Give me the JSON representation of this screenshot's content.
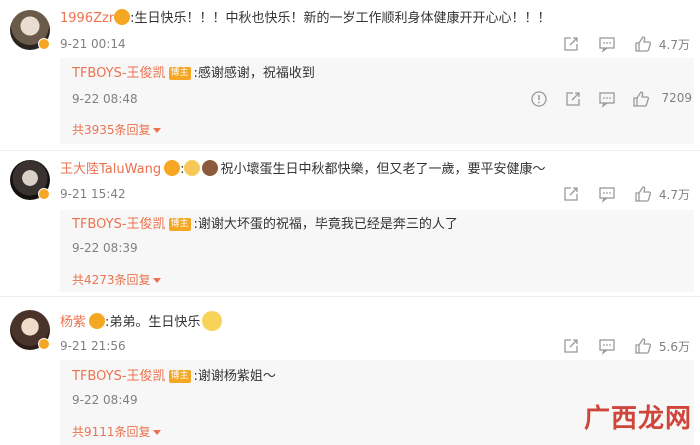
{
  "comments": [
    {
      "username": "1996Zzr",
      "text": ":生日快乐！！！中秋也快乐！新的一岁工作顺利身体健康开开心心！！！",
      "time": "9-21 00:14",
      "likes": "4.7万",
      "reply": {
        "username": "TFBOYS-王俊凯",
        "tag": "博主",
        "text": ":感谢感谢，祝福收到",
        "time": "9-22 08:48",
        "likes": "7209",
        "more_replies": "共3935条回复"
      }
    },
    {
      "username": "王大陸TaluWang",
      "text": "祝小壞蛋生日中秋都快樂，但又老了一歲，要平安健康～",
      "time": "9-21 15:42",
      "likes": "4.7万",
      "reply": {
        "username": "TFBOYS-王俊凯",
        "tag": "博主",
        "text": ":谢谢大坏蛋的祝福，毕竟我已经是奔三的人了",
        "time": "9-22 08:39",
        "more_replies": "共4273条回复"
      }
    },
    {
      "username": "杨紫",
      "text": ":弟弟。生日快乐",
      "time": "9-21 21:56",
      "likes": "5.6万",
      "reply": {
        "username": "TFBOYS-王俊凯",
        "tag": "博主",
        "text": ":谢谢杨紫姐～",
        "time": "9-22 08:49",
        "more_replies": "共9111条回复"
      }
    }
  ],
  "icons": {
    "share": "share-icon",
    "comment": "comment-icon",
    "like": "thumbs-up-icon",
    "report": "report-icon",
    "vip_badge": "vip-badge-icon",
    "emoji": "emoji-icon"
  },
  "colors": {
    "username": "#eb7350",
    "tag": "#f5a623",
    "reply_bg": "#f7f7f7",
    "watermark": "#d0453a"
  },
  "watermark": "广西龙网"
}
